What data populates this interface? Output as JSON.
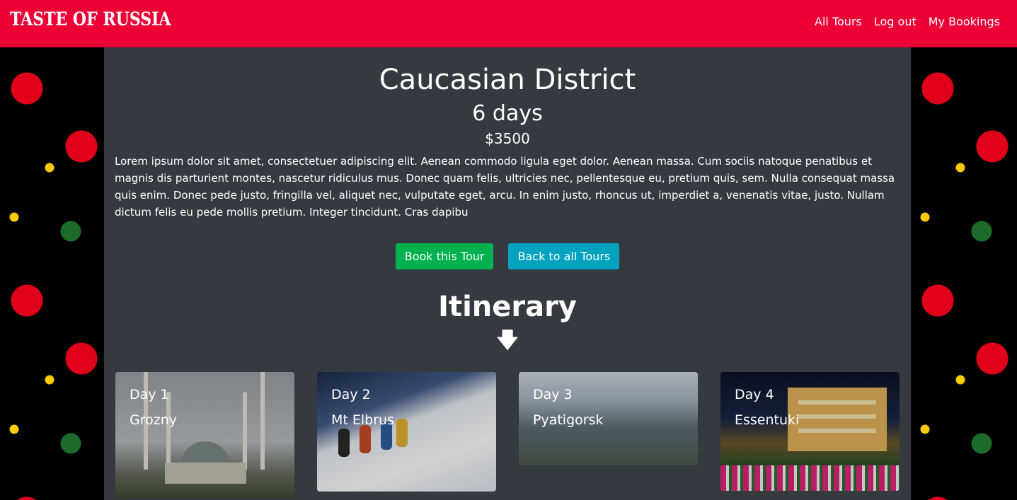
{
  "navbar": {
    "brand": "TASTE OF RUSSIA",
    "links": [
      "All Tours",
      "Log out",
      "My Bookings"
    ]
  },
  "tour": {
    "title": "Caucasian District",
    "days": "6 days",
    "price": "$3500",
    "description": "Lorem ipsum dolor sit amet, consectetuer adipiscing elit. Aenean commodo ligula eget dolor. Aenean massa. Cum sociis natoque penatibus et magnis dis parturient montes, nascetur ridiculus mus. Donec quam felis, ultricies nec, pellentesque eu, pretium quis, sem. Nulla consequat massa quis enim. Donec pede justo, fringilla vel, aliquet nec, vulputate eget, arcu. In enim justo, rhoncus ut, imperdiet a, venenatis vitae, justo. Nullam dictum felis eu pede mollis pretium. Integer tincidunt. Cras dapibu"
  },
  "buttons": {
    "book": "Book this Tour",
    "back": "Back to all Tours"
  },
  "itinerary": {
    "heading": "Itinerary",
    "arrow_icon": "arrow-down-icon",
    "days": [
      {
        "day": "Day 1",
        "place": "Grozny"
      },
      {
        "day": "Day 2",
        "place": "Mt Elbrus"
      },
      {
        "day": "Day 3",
        "place": "Pyatigorsk"
      },
      {
        "day": "Day 4",
        "place": "Essentuki"
      }
    ]
  },
  "colors": {
    "navbar": "#ec0036",
    "content_bg": "#343a40",
    "book_button": "#00b14f",
    "back_button": "#00a3bf"
  }
}
